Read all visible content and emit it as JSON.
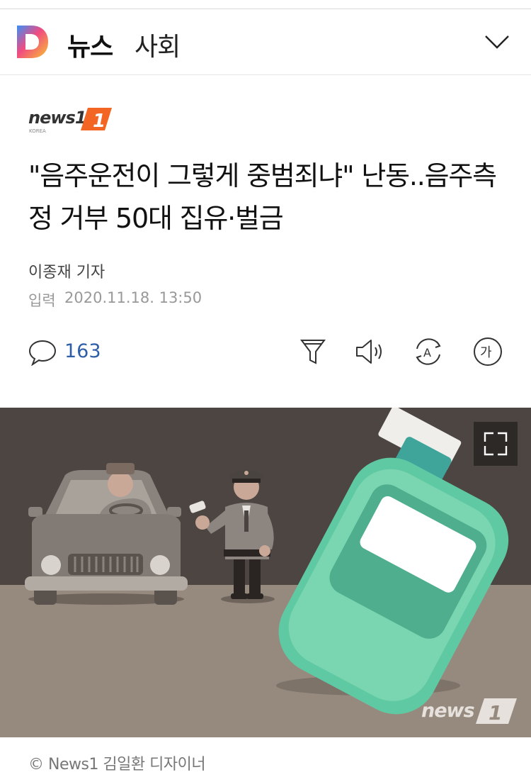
{
  "header": {
    "section_main": "뉴스",
    "section_sub": "사회"
  },
  "press": {
    "name": "news1",
    "sub": "KOREA"
  },
  "article": {
    "title": "\"음주운전이 그렇게 중범죄냐\" 난동..음주측정 거부 50대 집유·벌금",
    "reporter": "이종재 기자",
    "date_label": "입력",
    "date": "2020.11.18. 13:50"
  },
  "toolbar": {
    "comment_count": "163",
    "font_icon_label": "가",
    "translate_icon_label": "A"
  },
  "photo": {
    "watermark": "news",
    "watermark_num": "1",
    "caption": "© News1 김일환 디자이너"
  },
  "colors": {
    "accent_blue": "#2f5ea8",
    "news1_orange": "#f26522",
    "device_green": "#5fc9a3"
  }
}
